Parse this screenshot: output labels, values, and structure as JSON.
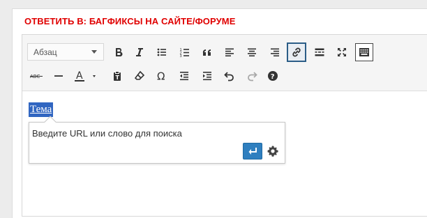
{
  "reply": {
    "title": "ОТВЕТИТЬ В: БАГФИКСЫ НА САЙТЕ/ФОРУМЕ"
  },
  "toolbar": {
    "format_select": {
      "value": "Абзац"
    },
    "row1_icons": [
      "bold-icon",
      "italic-icon",
      "bullet-list-icon",
      "numbered-list-icon",
      "blockquote-icon",
      "align-left-icon",
      "align-center-icon",
      "align-right-icon",
      "link-icon",
      "read-more-icon",
      "fullscreen-icon",
      "toolbar-toggle-icon"
    ],
    "row2_icons": [
      "strikethrough-icon",
      "horizontal-line-icon",
      "text-color-icon",
      "paste-text-icon",
      "clear-formatting-icon",
      "special-character-icon",
      "outdent-icon",
      "indent-icon",
      "undo-icon",
      "redo-icon",
      "help-icon"
    ],
    "active_icon": "link-icon"
  },
  "editor": {
    "selected_text": "Тема",
    "link_popup": {
      "input_placeholder": "Введите URL или слово для поиска",
      "apply_icon": "enter-icon",
      "settings_icon": "gear-icon"
    }
  },
  "colors": {
    "title": "#e00000",
    "selection": "#3166c1",
    "apply_button": "#2f7fbf",
    "active_border": "#2b5d87"
  }
}
